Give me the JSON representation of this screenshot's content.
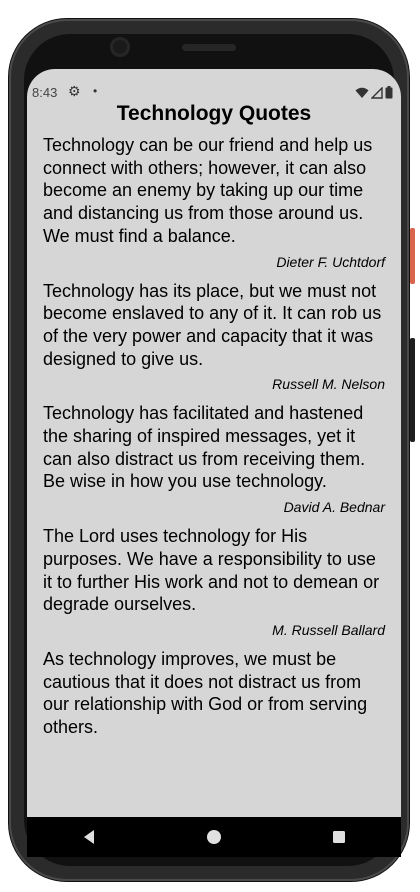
{
  "status_bar": {
    "time": "8:43",
    "icons": [
      "gear-icon",
      "notification-dot-icon",
      "wifi-icon",
      "cellular-signal-icon",
      "battery-icon"
    ]
  },
  "page": {
    "title": "Technology Quotes"
  },
  "quotes": [
    {
      "text": "Technology can be our friend and help us connect with others; however, it can also become an enemy by taking up our time and distancing us from those around us. We must find a balance.",
      "author": "Dieter F. Uchtdorf"
    },
    {
      "text": "Technology has its place, but we must not become enslaved to any of it. It can rob us of the very power and capacity that it was designed to give us.",
      "author": "Russell M. Nelson"
    },
    {
      "text": "Technology has facilitated and hastened the sharing of inspired messages, yet it can also distract us from receiving them. Be wise in how you use technology.",
      "author": "David A. Bednar"
    },
    {
      "text": "The Lord uses technology for His purposes. We have a responsibility to use it to further His work and not to demean or degrade ourselves.",
      "author": "M. Russell Ballard"
    },
    {
      "text": "As technology improves, we must be cautious that it does not distract us from our relationship with God or from serving others.",
      "author": ""
    }
  ],
  "nav_bar": {
    "buttons": [
      "back-icon",
      "home-icon",
      "recents-icon"
    ]
  },
  "colors": {
    "screen_bg": "#d6d6d6",
    "nav_bg": "#000000",
    "frame": "#2b2b2b"
  }
}
